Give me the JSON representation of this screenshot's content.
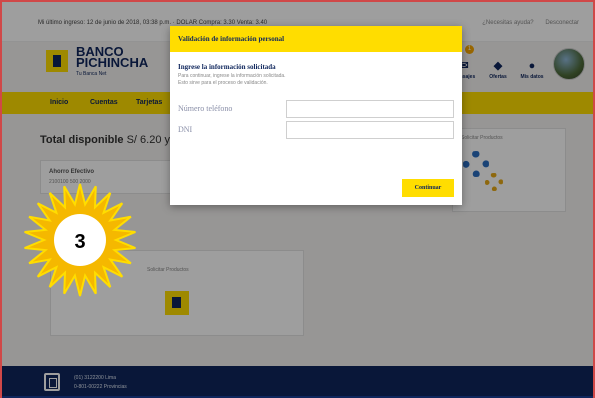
{
  "topbar": {
    "last_login": "Mi último ingreso: 12 de junio de 2018, 03:38 p.m. · DOLAR Compra: 3.30 Venta: 3.40",
    "links": [
      "¿Necesitas ayuda?",
      "Desconectar"
    ]
  },
  "brand": {
    "name_line1": "BANCO",
    "name_line2": "PICHINCHA",
    "tagline": "Tu Banca Net"
  },
  "header": {
    "items": [
      {
        "label": "Mensajes",
        "icon": "mail-icon",
        "glyph": "✉"
      },
      {
        "label": "Ofertas",
        "icon": "tag-icon",
        "glyph": "◆"
      },
      {
        "label": "Mis datos",
        "icon": "user-icon",
        "glyph": "●"
      }
    ],
    "badge": "1"
  },
  "nav": {
    "items": [
      "Inicio",
      "Cuentas",
      "Tarjetas"
    ]
  },
  "dashboard": {
    "total_label": "Total disponible",
    "total_value": "S/ 6.20 y U",
    "account_name": "Ahorro Efectivo",
    "account_number": "2100100 500 2000",
    "products_label_right": "Solicitar Productos",
    "products_label": "Solicitar Productos"
  },
  "footer": {
    "line1": "(01) 3122200 Lima",
    "line2": "0-801-00222 Provincias"
  },
  "modal": {
    "title": "Validación de información personal",
    "subtitle": "Ingrese la información solicitada",
    "desc_line1": "Para continuar, ingrese la información solicitada.",
    "desc_line2": "Esto sirve para el proceso de validación.",
    "phone_label": "Número teléfono",
    "phone_value": "",
    "dni_label": "DNI",
    "dni_value": "",
    "continue_label": "Continuar"
  },
  "step_marker": {
    "number": "3",
    "fill_color": "#f5b800",
    "accent_color": "#ffdd00"
  },
  "colors": {
    "brand_navy": "#0f265c",
    "brand_yellow": "#ffdd00",
    "frame_red": "#d04848"
  }
}
